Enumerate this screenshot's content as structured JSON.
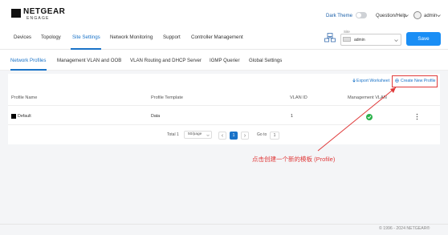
{
  "brand": {
    "name": "NETGEAR",
    "sub": "ENGAGE"
  },
  "header": {
    "dark_theme": "Dark Theme",
    "help": "Question/Help",
    "user": "admin"
  },
  "nav": {
    "items": [
      "Devices",
      "Topology",
      "Site Settings",
      "Network Monitoring",
      "Support",
      "Controller Management"
    ],
    "active": "Site Settings"
  },
  "site": {
    "label": "Site",
    "value": "admin"
  },
  "save_label": "Save",
  "tabs": {
    "items": [
      "Network Profiles",
      "Management VLAN and OOB",
      "VLAN Routing and DHCP Server",
      "IGMP Querier",
      "Global Settings"
    ],
    "active": "Network Profiles"
  },
  "actions": {
    "export": "Export Worksheet",
    "create": "Create New Profile"
  },
  "table": {
    "headers": [
      "Profile Name",
      "Profile Template",
      "VLAN ID",
      "Management VLAN"
    ],
    "rows": [
      {
        "name": "Default",
        "template": "Data",
        "vlan_id": "1",
        "management": true
      }
    ]
  },
  "pagination": {
    "total": "Total 1",
    "per_page": "50/page",
    "current": "1",
    "goto_label": "Go to",
    "goto_value": "1"
  },
  "annotation": "点击创建一个新的模板 (Profile)",
  "footer": {
    "copyright": "© 1996 - 2024 NETGEAR®"
  },
  "colors": {
    "accent": "#1a73c8",
    "save": "#1a8ef5",
    "annotation": "#e03a3a",
    "success": "#2ab24a"
  }
}
